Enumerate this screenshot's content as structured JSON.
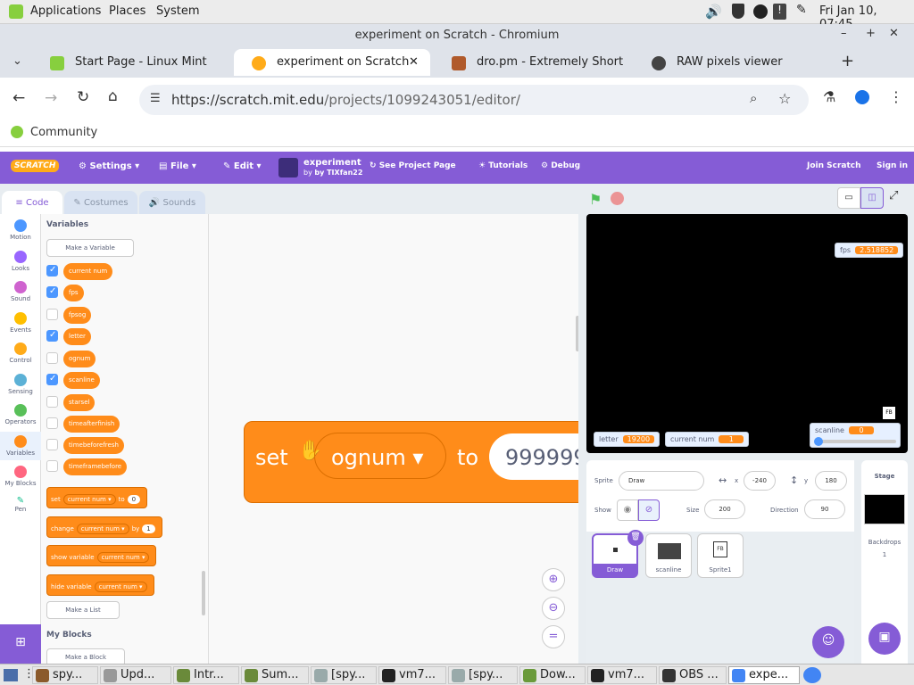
{
  "os": {
    "menu": [
      "Applications",
      "Places",
      "System"
    ],
    "clock": "Fri Jan 10, 07:45"
  },
  "window": {
    "title": "experiment on Scratch - Chromium"
  },
  "tabs": [
    {
      "label": "Start Page - Linux Mint"
    },
    {
      "label": "experiment on Scratch"
    },
    {
      "label": "dro.pm - Extremely Short"
    },
    {
      "label": "RAW pixels viewer"
    }
  ],
  "address": {
    "url_host": "https://scratch.mit.edu",
    "url_path": "/projects/1099243051/editor/"
  },
  "bookmarks": [
    {
      "label": "Community"
    }
  ],
  "scratch_menu": {
    "logo": "SCRATCH",
    "settings": "Settings",
    "file": "File",
    "edit": "Edit",
    "project_title": "experiment",
    "project_author": "by TIXfan22",
    "see_project": "See Project Page",
    "tutorials": "Tutorials",
    "debug": "Debug",
    "join": "Join Scratch",
    "signin": "Sign in"
  },
  "editor_tabs": {
    "code": "Code",
    "costumes": "Costumes",
    "sounds": "Sounds"
  },
  "categories": [
    {
      "label": "Motion",
      "color": "#4c97ff"
    },
    {
      "label": "Looks",
      "color": "#9966ff"
    },
    {
      "label": "Sound",
      "color": "#cf63cf"
    },
    {
      "label": "Events",
      "color": "#ffbf00"
    },
    {
      "label": "Control",
      "color": "#ffab19"
    },
    {
      "label": "Sensing",
      "color": "#5cb1d6"
    },
    {
      "label": "Operators",
      "color": "#59c059"
    },
    {
      "label": "Variables",
      "color": "#ff8c1a"
    },
    {
      "label": "My Blocks",
      "color": "#ff6680"
    },
    {
      "label": "Pen",
      "color": "#0fbd8c"
    }
  ],
  "palette": {
    "heading": "Variables",
    "make_variable": "Make a Variable",
    "variables": [
      {
        "name": "current num",
        "checked": true
      },
      {
        "name": "fps",
        "checked": true
      },
      {
        "name": "fpsog",
        "checked": false
      },
      {
        "name": "letter",
        "checked": true
      },
      {
        "name": "ognum",
        "checked": false
      },
      {
        "name": "scanline",
        "checked": true
      },
      {
        "name": "starsel",
        "checked": false
      },
      {
        "name": "timeafterfinish",
        "checked": false
      },
      {
        "name": "timebeforefresh",
        "checked": false
      },
      {
        "name": "timeframebefore",
        "checked": false
      }
    ],
    "set_block": {
      "word": "set",
      "var": "current num",
      "to": "to",
      "value": "0"
    },
    "change_block": {
      "word": "change",
      "var": "current num",
      "by": "by",
      "value": "1"
    },
    "show_block": {
      "word": "show variable",
      "var": "current num"
    },
    "hide_block": {
      "word": "hide variable",
      "var": "current num"
    },
    "make_list": "Make a List",
    "myblocks_heading": "My Blocks",
    "make_block": "Make a Block"
  },
  "workspace_block": {
    "word": "set",
    "var": "ognum",
    "to": "to",
    "value": "999999"
  },
  "stage": {
    "monitors": {
      "fps_label": "fps",
      "fps_value": "2.518852",
      "letter_label": "letter",
      "letter_value": "19200",
      "current_label": "current num",
      "current_value": "1",
      "scanline_label": "scanline",
      "scanline_value": "0"
    },
    "fb_label": "FB"
  },
  "sprite_info": {
    "sprite_label": "Sprite",
    "sprite_name": "Draw",
    "x_label": "x",
    "x_value": "-240",
    "y_label": "y",
    "y_value": "180",
    "show_label": "Show",
    "size_label": "Size",
    "size_value": "200",
    "direction_label": "Direction",
    "direction_value": "90"
  },
  "sprites": [
    {
      "name": "Draw",
      "selected": true
    },
    {
      "name": "scanline",
      "selected": false
    },
    {
      "name": "Sprite1",
      "selected": false
    }
  ],
  "sprite1_thumb": "FB",
  "stage_pane": {
    "title": "Stage",
    "backdrops_label": "Backdrops",
    "backdrops_count": "1"
  },
  "taskbar": [
    {
      "label": "spy...",
      "color": "#8b5a2b"
    },
    {
      "label": "Upd...",
      "color": "#999"
    },
    {
      "label": "Intr...",
      "color": "#6a8a3a"
    },
    {
      "label": "Sum...",
      "color": "#6a8a3a"
    },
    {
      "label": "[spy...",
      "color": "#9aa"
    },
    {
      "label": "vm7...",
      "color": "#222"
    },
    {
      "label": "[spy...",
      "color": "#9aa"
    },
    {
      "label": "Dow...",
      "color": "#6a9a3a"
    },
    {
      "label": "vm7...",
      "color": "#222"
    },
    {
      "label": "OBS ...",
      "color": "#333"
    },
    {
      "label": "expe...",
      "color": "#4285f4"
    }
  ]
}
